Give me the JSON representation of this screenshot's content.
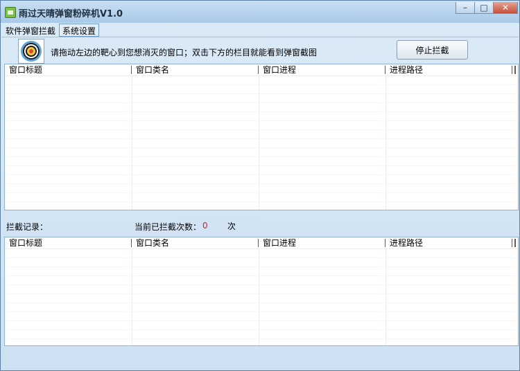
{
  "window": {
    "title": "雨过天晴弹窗粉碎机V1.0",
    "controls": {
      "minimize": "–",
      "maximize": "□",
      "close": "✕"
    }
  },
  "tabs": [
    {
      "label": "软件弹窗拦截",
      "active": true
    },
    {
      "label": "系统设置",
      "active": false
    }
  ],
  "interception": {
    "target_icon": "bullseye-target-icon",
    "instruction": "请拖动左边的靶心到您想消灭的窗口；双击下方的栏目就能看到弹窗截图",
    "stop_button": "停止拦截"
  },
  "window_list": {
    "columns": [
      "窗口标题",
      "窗口类名",
      "窗口进程",
      "进程路径"
    ],
    "rows": []
  },
  "log": {
    "label": "拦截记录：",
    "count_label": "当前已拦截次数：",
    "count_value": "0",
    "count_unit": "次",
    "columns": [
      "窗口标题",
      "窗口类名",
      "窗口进程",
      "进程路径"
    ],
    "rows": []
  },
  "colors": {
    "accent": "#7cc04a",
    "count": "#d02020",
    "border": "#8db3d6"
  }
}
